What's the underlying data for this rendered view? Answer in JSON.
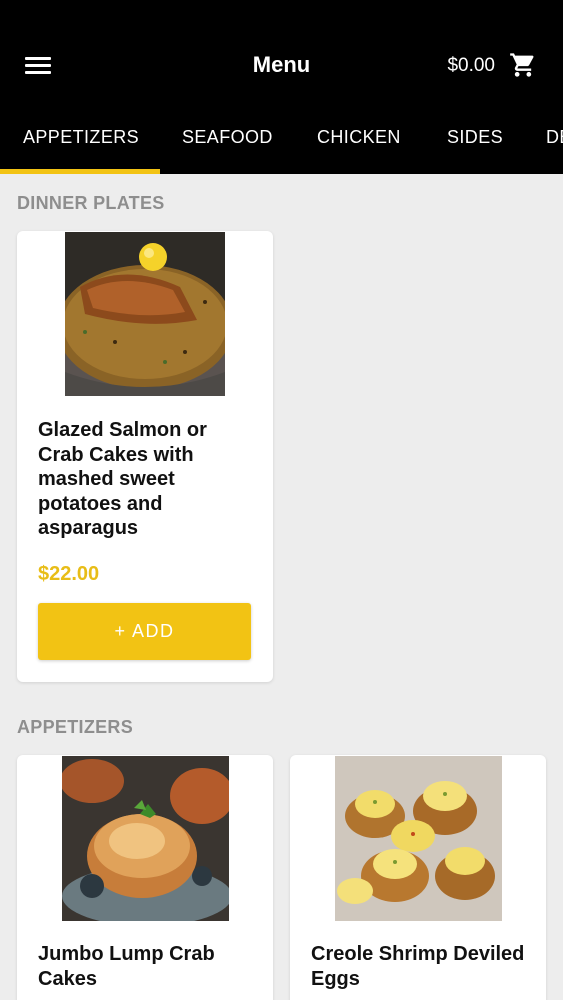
{
  "header": {
    "title": "Menu",
    "cart_total": "$0.00"
  },
  "tabs": [
    "APPETIZERS",
    "SEAFOOD",
    "CHICKEN",
    "SIDES",
    "DESSERTS"
  ],
  "sections": [
    {
      "title": "DINNER PLATES",
      "items": [
        {
          "name": "Glazed Salmon or Crab Cakes with mashed sweet potatoes and asparagus",
          "price": "$22.00",
          "add_label": "+ ADD"
        }
      ]
    },
    {
      "title": "APPETIZERS",
      "items": [
        {
          "name": "Jumbo Lump Crab Cakes"
        },
        {
          "name": "Creole Shrimp Deviled Eggs"
        }
      ]
    }
  ],
  "colors": {
    "accent": "#f2c314",
    "price": "#e8bd17",
    "header_bg": "#000000",
    "page_bg": "#ededed"
  }
}
